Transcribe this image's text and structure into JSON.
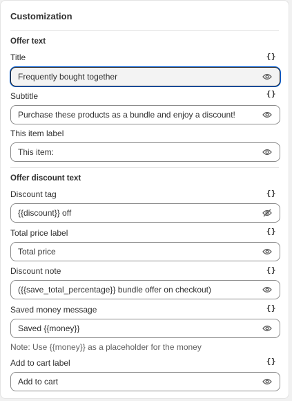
{
  "card": {
    "title": "Customization"
  },
  "sections": {
    "offer_text": "Offer text",
    "offer_discount_text": "Offer discount text"
  },
  "braces_label": "{}",
  "fields": [
    {
      "label": "Title",
      "value": "Frequently bought together",
      "has_braces": true,
      "visibility": "visible",
      "focused": true
    },
    {
      "label": "Subtitle",
      "value": "Purchase these products as a bundle and enjoy a discount!",
      "has_braces": true,
      "visibility": "visible"
    },
    {
      "label": "This item label",
      "value": "This item:",
      "has_braces": false,
      "visibility": "visible"
    },
    {
      "label": "Discount tag",
      "value": "{{discount}} off",
      "has_braces": true,
      "visibility": "hidden"
    },
    {
      "label": "Total price label",
      "value": "Total price",
      "has_braces": true,
      "visibility": "visible"
    },
    {
      "label": "Discount note",
      "value": "({{save_total_percentage}} bundle offer on checkout)",
      "has_braces": true,
      "visibility": "visible"
    },
    {
      "label": "Saved money message",
      "value": "Saved {{money}}",
      "has_braces": true,
      "visibility": "visible"
    },
    {
      "label": "Add to cart label",
      "value": "Add to cart",
      "has_braces": true,
      "visibility": "visible"
    }
  ],
  "notes": {
    "saved_money": "Note: Use {{money}} as a placeholder for the money"
  },
  "icons": {
    "visible": "eye-icon",
    "hidden": "eye-slash-icon"
  },
  "colors": {
    "focus_ring": "#005bd3",
    "text": "#303030",
    "border": "#8a8a8a"
  }
}
